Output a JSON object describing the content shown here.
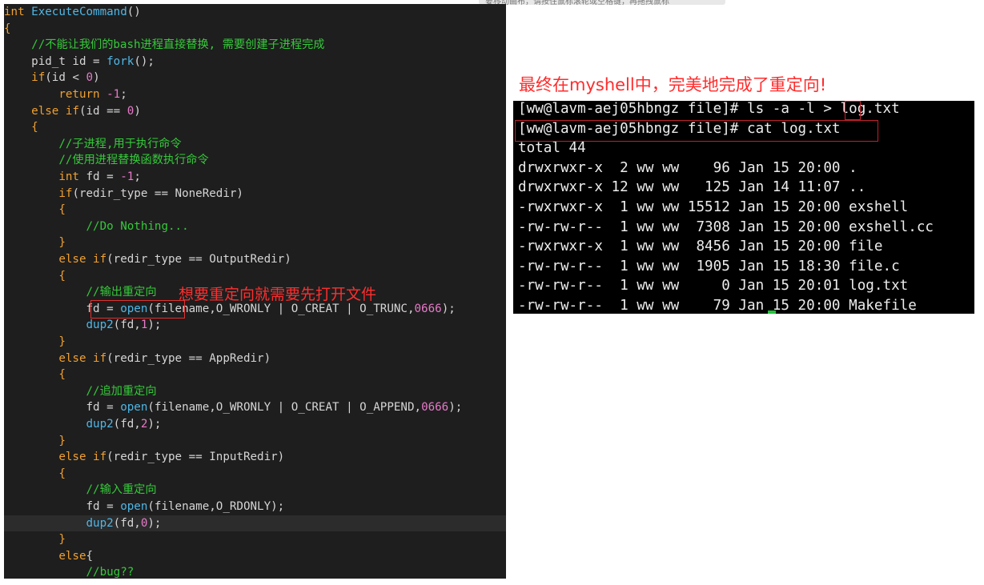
{
  "tooltip": "要移动画布，请按住鼠标滚轮或空格键，再拖拽鼠标",
  "headline": "最终在myshell中，完美地完成了重定向!",
  "editor": {
    "lines": [
      {
        "indent": "",
        "segs": [
          {
            "c": "kw",
            "t": "int "
          },
          {
            "c": "call",
            "t": "ExecuteCommand"
          },
          {
            "c": "fn",
            "t": "()"
          }
        ]
      },
      {
        "indent": "",
        "segs": [
          {
            "c": "kw",
            "t": "{"
          }
        ]
      },
      {
        "indent": "    ",
        "segs": [
          {
            "c": "com",
            "t": "//不能让我们的bash进程直接替换, 需要创建子进程完成"
          }
        ]
      },
      {
        "indent": "    ",
        "segs": [
          {
            "c": "fn",
            "t": "pid_t id = "
          },
          {
            "c": "call",
            "t": "fork"
          },
          {
            "c": "fn",
            "t": "();"
          }
        ]
      },
      {
        "indent": "    ",
        "segs": [
          {
            "c": "kw",
            "t": "if"
          },
          {
            "c": "fn",
            "t": "(id < "
          },
          {
            "c": "num",
            "t": "0"
          },
          {
            "c": "fn",
            "t": ")"
          }
        ]
      },
      {
        "indent": "        ",
        "segs": [
          {
            "c": "ret",
            "t": "return "
          },
          {
            "c": "num",
            "t": "-1"
          },
          {
            "c": "fn",
            "t": ";"
          }
        ]
      },
      {
        "indent": "    ",
        "segs": [
          {
            "c": "kw",
            "t": "else if"
          },
          {
            "c": "fn",
            "t": "(id == "
          },
          {
            "c": "num",
            "t": "0"
          },
          {
            "c": "fn",
            "t": ")"
          }
        ]
      },
      {
        "indent": "    ",
        "segs": [
          {
            "c": "kw",
            "t": "{"
          }
        ]
      },
      {
        "indent": "        ",
        "segs": [
          {
            "c": "com",
            "t": "//子进程,用于执行命令"
          }
        ]
      },
      {
        "indent": "        ",
        "segs": [
          {
            "c": "com",
            "t": "//使用进程替换函数执行命令"
          }
        ]
      },
      {
        "indent": "        ",
        "segs": [
          {
            "c": "kw",
            "t": "int "
          },
          {
            "c": "fn",
            "t": "fd = "
          },
          {
            "c": "num",
            "t": "-1"
          },
          {
            "c": "fn",
            "t": ";"
          }
        ]
      },
      {
        "indent": "        ",
        "segs": [
          {
            "c": "kw",
            "t": "if"
          },
          {
            "c": "fn",
            "t": "(redir_type == NoneRedir)"
          }
        ]
      },
      {
        "indent": "        ",
        "segs": [
          {
            "c": "kw",
            "t": "{"
          }
        ]
      },
      {
        "indent": "            ",
        "segs": [
          {
            "c": "com",
            "t": "//Do Nothing..."
          }
        ]
      },
      {
        "indent": "        ",
        "segs": [
          {
            "c": "kw",
            "t": "}"
          }
        ]
      },
      {
        "indent": "        ",
        "segs": [
          {
            "c": "kw",
            "t": "else if"
          },
          {
            "c": "fn",
            "t": "(redir_type == OutputRedir)"
          }
        ]
      },
      {
        "indent": "        ",
        "segs": [
          {
            "c": "kw",
            "t": "{"
          }
        ]
      },
      {
        "indent": "            ",
        "segs": [
          {
            "c": "com",
            "t": "//输出重定向"
          }
        ]
      },
      {
        "indent": "            ",
        "segs": [
          {
            "c": "fn",
            "t": "fd = "
          },
          {
            "c": "call",
            "t": "open"
          },
          {
            "c": "fn",
            "t": "(filename,O_WRONLY | O_CREAT | O_TRUNC,"
          },
          {
            "c": "num",
            "t": "0666"
          },
          {
            "c": "fn",
            "t": ");"
          }
        ]
      },
      {
        "indent": "            ",
        "segs": [
          {
            "c": "call",
            "t": "dup2"
          },
          {
            "c": "fn",
            "t": "(fd,"
          },
          {
            "c": "num",
            "t": "1"
          },
          {
            "c": "fn",
            "t": ");"
          }
        ]
      },
      {
        "indent": "        ",
        "segs": [
          {
            "c": "kw",
            "t": "}"
          }
        ]
      },
      {
        "indent": "        ",
        "segs": [
          {
            "c": "kw",
            "t": "else if"
          },
          {
            "c": "fn",
            "t": "(redir_type == AppRedir)"
          }
        ]
      },
      {
        "indent": "        ",
        "segs": [
          {
            "c": "kw",
            "t": "{"
          }
        ]
      },
      {
        "indent": "            ",
        "segs": [
          {
            "c": "com",
            "t": "//追加重定向"
          }
        ]
      },
      {
        "indent": "            ",
        "segs": [
          {
            "c": "fn",
            "t": "fd = "
          },
          {
            "c": "call",
            "t": "open"
          },
          {
            "c": "fn",
            "t": "(filename,O_WRONLY | O_CREAT | O_APPEND,"
          },
          {
            "c": "num",
            "t": "0666"
          },
          {
            "c": "fn",
            "t": ");"
          }
        ]
      },
      {
        "indent": "            ",
        "segs": [
          {
            "c": "call",
            "t": "dup2"
          },
          {
            "c": "fn",
            "t": "(fd,"
          },
          {
            "c": "num",
            "t": "2"
          },
          {
            "c": "fn",
            "t": ");"
          }
        ]
      },
      {
        "indent": "        ",
        "segs": [
          {
            "c": "kw",
            "t": "}"
          }
        ]
      },
      {
        "indent": "        ",
        "segs": [
          {
            "c": "kw",
            "t": "else if"
          },
          {
            "c": "fn",
            "t": "(redir_type == InputRedir)"
          }
        ]
      },
      {
        "indent": "        ",
        "segs": [
          {
            "c": "kw",
            "t": "{"
          }
        ]
      },
      {
        "indent": "            ",
        "segs": [
          {
            "c": "com",
            "t": "//输入重定向"
          }
        ]
      },
      {
        "indent": "            ",
        "segs": [
          {
            "c": "fn",
            "t": "fd = "
          },
          {
            "c": "call",
            "t": "open"
          },
          {
            "c": "fn",
            "t": "(filename,O_RDONLY);"
          }
        ]
      },
      {
        "indent": "            ",
        "segs": [
          {
            "c": "call",
            "t": "dup2"
          },
          {
            "c": "fn",
            "t": "(fd,"
          },
          {
            "c": "num",
            "t": "0"
          },
          {
            "c": "fn",
            "t": ");"
          }
        ],
        "current": true
      },
      {
        "indent": "        ",
        "segs": [
          {
            "c": "kw",
            "t": "}"
          }
        ]
      },
      {
        "indent": "        ",
        "segs": [
          {
            "c": "kw",
            "t": "else"
          },
          {
            "c": "fn",
            "t": "{"
          }
        ]
      },
      {
        "indent": "            ",
        "segs": [
          {
            "c": "com",
            "t": "//bug??"
          }
        ]
      },
      {
        "indent": "        ",
        "segs": [
          {
            "c": "kw",
            "t": "}"
          }
        ]
      }
    ],
    "annotation": "想要重定向就需要先打开文件"
  },
  "terminal": {
    "lines": [
      "[ww@lavm-aej05hbngz file]# ls -a -l > log.txt",
      "[ww@lavm-aej05hbngz file]# cat log.txt",
      "total 44",
      "drwxrwxr-x  2 ww ww    96 Jan 15 20:00 .",
      "drwxrwxr-x 12 ww ww   125 Jan 14 11:07 ..",
      "-rwxrwxr-x  1 ww ww 15512 Jan 15 20:00 exshell",
      "-rw-rw-r--  1 ww ww  7308 Jan 15 20:00 exshell.cc",
      "-rwxrwxr-x  1 ww ww  8456 Jan 15 20:00 file",
      "-rw-rw-r--  1 ww ww  1905 Jan 15 18:30 file.c",
      "-rw-rw-r--  1 ww ww     0 Jan 15 20:01 log.txt",
      "-rw-rw-r--  1 ww ww    79 Jan 15 20:00 Makefile"
    ]
  }
}
